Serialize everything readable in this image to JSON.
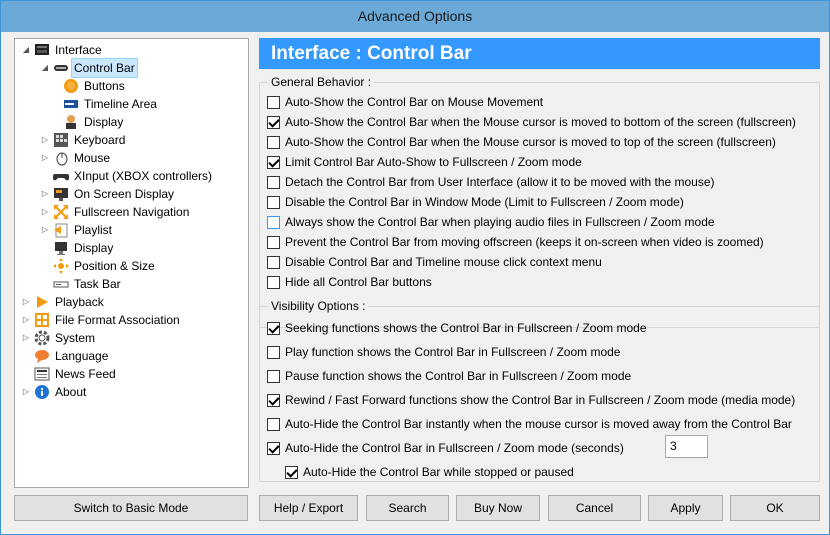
{
  "window": {
    "title": "Advanced Options"
  },
  "header": {
    "title": "Interface : Control Bar"
  },
  "tree": {
    "items": [
      {
        "label": "Interface",
        "icon": "interface-icon"
      },
      {
        "label": "Control Bar",
        "icon": "control-bar-icon"
      },
      {
        "label": "Buttons",
        "icon": "buttons-icon"
      },
      {
        "label": "Timeline Area",
        "icon": "timeline-icon"
      },
      {
        "label": "Display",
        "icon": "display-icon"
      },
      {
        "label": "Keyboard",
        "icon": "keyboard-icon"
      },
      {
        "label": "Mouse",
        "icon": "mouse-icon"
      },
      {
        "label": "XInput (XBOX controllers)",
        "icon": "gamepad-icon"
      },
      {
        "label": "On Screen Display",
        "icon": "osd-icon"
      },
      {
        "label": "Fullscreen Navigation",
        "icon": "fullscreen-icon"
      },
      {
        "label": "Playlist",
        "icon": "playlist-icon"
      },
      {
        "label": "Display",
        "icon": "monitor-icon"
      },
      {
        "label": "Position & Size",
        "icon": "position-icon"
      },
      {
        "label": "Task Bar",
        "icon": "taskbar-icon"
      },
      {
        "label": "Playback",
        "icon": "playback-icon"
      },
      {
        "label": "File Format Association",
        "icon": "file-association-icon"
      },
      {
        "label": "System",
        "icon": "system-gear-icon"
      },
      {
        "label": "Language",
        "icon": "language-icon"
      },
      {
        "label": "News Feed",
        "icon": "news-icon"
      },
      {
        "label": "About",
        "icon": "about-info-icon"
      }
    ]
  },
  "general": {
    "legend": "General Behavior :",
    "options": [
      {
        "label": "Auto-Show the Control Bar on Mouse Movement",
        "checked": false
      },
      {
        "label": "Auto-Show the Control Bar when the Mouse cursor is moved to bottom of the screen (fullscreen)",
        "checked": true
      },
      {
        "label": "Auto-Show the Control Bar when the Mouse cursor is moved to top of the screen (fullscreen)",
        "checked": false
      },
      {
        "label": "Limit Control Bar Auto-Show to Fullscreen / Zoom mode",
        "checked": true
      },
      {
        "label": "Detach the Control Bar from User Interface (allow it to be moved with the mouse)",
        "checked": false
      },
      {
        "label": "Disable the Control Bar in Window Mode (Limit to Fullscreen / Zoom mode)",
        "checked": false
      },
      {
        "label": "Always show the Control Bar when playing audio files in Fullscreen / Zoom mode",
        "checked": false
      },
      {
        "label": "Prevent the Control Bar from moving offscreen (keeps it on-screen when video is zoomed)",
        "checked": false
      },
      {
        "label": "Disable Control Bar and Timeline mouse click context menu",
        "checked": false
      },
      {
        "label": "Hide all Control Bar buttons",
        "checked": false
      }
    ]
  },
  "visibility": {
    "legend": "Visibility Options :",
    "options": [
      {
        "label": "Seeking functions shows the Control Bar in Fullscreen / Zoom mode",
        "checked": true
      },
      {
        "label": "Play function shows the Control Bar in Fullscreen / Zoom mode",
        "checked": false
      },
      {
        "label": "Pause function shows the Control Bar in Fullscreen / Zoom mode",
        "checked": false
      },
      {
        "label": "Rewind / Fast Forward functions show the Control Bar in Fullscreen / Zoom mode (media mode)",
        "checked": true
      },
      {
        "label": "Auto-Hide the Control Bar instantly when the mouse cursor is moved away from the Control Bar",
        "checked": false
      },
      {
        "label": "Auto-Hide the Control Bar in Fullscreen / Zoom mode (seconds)",
        "checked": true
      },
      {
        "label": "Auto-Hide the Control Bar while stopped or paused",
        "checked": true
      }
    ],
    "seconds_value": "3"
  },
  "buttons": {
    "basic_mode": "Switch to Basic Mode",
    "help": "Help / Export",
    "search": "Search",
    "buy": "Buy Now",
    "cancel": "Cancel",
    "apply": "Apply",
    "ok": "OK"
  }
}
